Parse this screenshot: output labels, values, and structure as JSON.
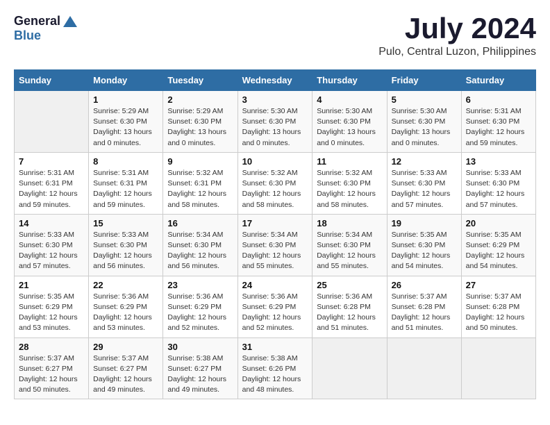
{
  "logo": {
    "general": "General",
    "blue": "Blue"
  },
  "title": "July 2024",
  "location": "Pulo, Central Luzon, Philippines",
  "headers": [
    "Sunday",
    "Monday",
    "Tuesday",
    "Wednesday",
    "Thursday",
    "Friday",
    "Saturday"
  ],
  "weeks": [
    [
      {
        "day": "",
        "info": ""
      },
      {
        "day": "1",
        "info": "Sunrise: 5:29 AM\nSunset: 6:30 PM\nDaylight: 13 hours\nand 0 minutes."
      },
      {
        "day": "2",
        "info": "Sunrise: 5:29 AM\nSunset: 6:30 PM\nDaylight: 13 hours\nand 0 minutes."
      },
      {
        "day": "3",
        "info": "Sunrise: 5:30 AM\nSunset: 6:30 PM\nDaylight: 13 hours\nand 0 minutes."
      },
      {
        "day": "4",
        "info": "Sunrise: 5:30 AM\nSunset: 6:30 PM\nDaylight: 13 hours\nand 0 minutes."
      },
      {
        "day": "5",
        "info": "Sunrise: 5:30 AM\nSunset: 6:30 PM\nDaylight: 13 hours\nand 0 minutes."
      },
      {
        "day": "6",
        "info": "Sunrise: 5:31 AM\nSunset: 6:30 PM\nDaylight: 12 hours\nand 59 minutes."
      }
    ],
    [
      {
        "day": "7",
        "info": "Sunrise: 5:31 AM\nSunset: 6:31 PM\nDaylight: 12 hours\nand 59 minutes."
      },
      {
        "day": "8",
        "info": "Sunrise: 5:31 AM\nSunset: 6:31 PM\nDaylight: 12 hours\nand 59 minutes."
      },
      {
        "day": "9",
        "info": "Sunrise: 5:32 AM\nSunset: 6:31 PM\nDaylight: 12 hours\nand 58 minutes."
      },
      {
        "day": "10",
        "info": "Sunrise: 5:32 AM\nSunset: 6:30 PM\nDaylight: 12 hours\nand 58 minutes."
      },
      {
        "day": "11",
        "info": "Sunrise: 5:32 AM\nSunset: 6:30 PM\nDaylight: 12 hours\nand 58 minutes."
      },
      {
        "day": "12",
        "info": "Sunrise: 5:33 AM\nSunset: 6:30 PM\nDaylight: 12 hours\nand 57 minutes."
      },
      {
        "day": "13",
        "info": "Sunrise: 5:33 AM\nSunset: 6:30 PM\nDaylight: 12 hours\nand 57 minutes."
      }
    ],
    [
      {
        "day": "14",
        "info": "Sunrise: 5:33 AM\nSunset: 6:30 PM\nDaylight: 12 hours\nand 57 minutes."
      },
      {
        "day": "15",
        "info": "Sunrise: 5:33 AM\nSunset: 6:30 PM\nDaylight: 12 hours\nand 56 minutes."
      },
      {
        "day": "16",
        "info": "Sunrise: 5:34 AM\nSunset: 6:30 PM\nDaylight: 12 hours\nand 56 minutes."
      },
      {
        "day": "17",
        "info": "Sunrise: 5:34 AM\nSunset: 6:30 PM\nDaylight: 12 hours\nand 55 minutes."
      },
      {
        "day": "18",
        "info": "Sunrise: 5:34 AM\nSunset: 6:30 PM\nDaylight: 12 hours\nand 55 minutes."
      },
      {
        "day": "19",
        "info": "Sunrise: 5:35 AM\nSunset: 6:30 PM\nDaylight: 12 hours\nand 54 minutes."
      },
      {
        "day": "20",
        "info": "Sunrise: 5:35 AM\nSunset: 6:29 PM\nDaylight: 12 hours\nand 54 minutes."
      }
    ],
    [
      {
        "day": "21",
        "info": "Sunrise: 5:35 AM\nSunset: 6:29 PM\nDaylight: 12 hours\nand 53 minutes."
      },
      {
        "day": "22",
        "info": "Sunrise: 5:36 AM\nSunset: 6:29 PM\nDaylight: 12 hours\nand 53 minutes."
      },
      {
        "day": "23",
        "info": "Sunrise: 5:36 AM\nSunset: 6:29 PM\nDaylight: 12 hours\nand 52 minutes."
      },
      {
        "day": "24",
        "info": "Sunrise: 5:36 AM\nSunset: 6:29 PM\nDaylight: 12 hours\nand 52 minutes."
      },
      {
        "day": "25",
        "info": "Sunrise: 5:36 AM\nSunset: 6:28 PM\nDaylight: 12 hours\nand 51 minutes."
      },
      {
        "day": "26",
        "info": "Sunrise: 5:37 AM\nSunset: 6:28 PM\nDaylight: 12 hours\nand 51 minutes."
      },
      {
        "day": "27",
        "info": "Sunrise: 5:37 AM\nSunset: 6:28 PM\nDaylight: 12 hours\nand 50 minutes."
      }
    ],
    [
      {
        "day": "28",
        "info": "Sunrise: 5:37 AM\nSunset: 6:27 PM\nDaylight: 12 hours\nand 50 minutes."
      },
      {
        "day": "29",
        "info": "Sunrise: 5:37 AM\nSunset: 6:27 PM\nDaylight: 12 hours\nand 49 minutes."
      },
      {
        "day": "30",
        "info": "Sunrise: 5:38 AM\nSunset: 6:27 PM\nDaylight: 12 hours\nand 49 minutes."
      },
      {
        "day": "31",
        "info": "Sunrise: 5:38 AM\nSunset: 6:26 PM\nDaylight: 12 hours\nand 48 minutes."
      },
      {
        "day": "",
        "info": ""
      },
      {
        "day": "",
        "info": ""
      },
      {
        "day": "",
        "info": ""
      }
    ]
  ]
}
